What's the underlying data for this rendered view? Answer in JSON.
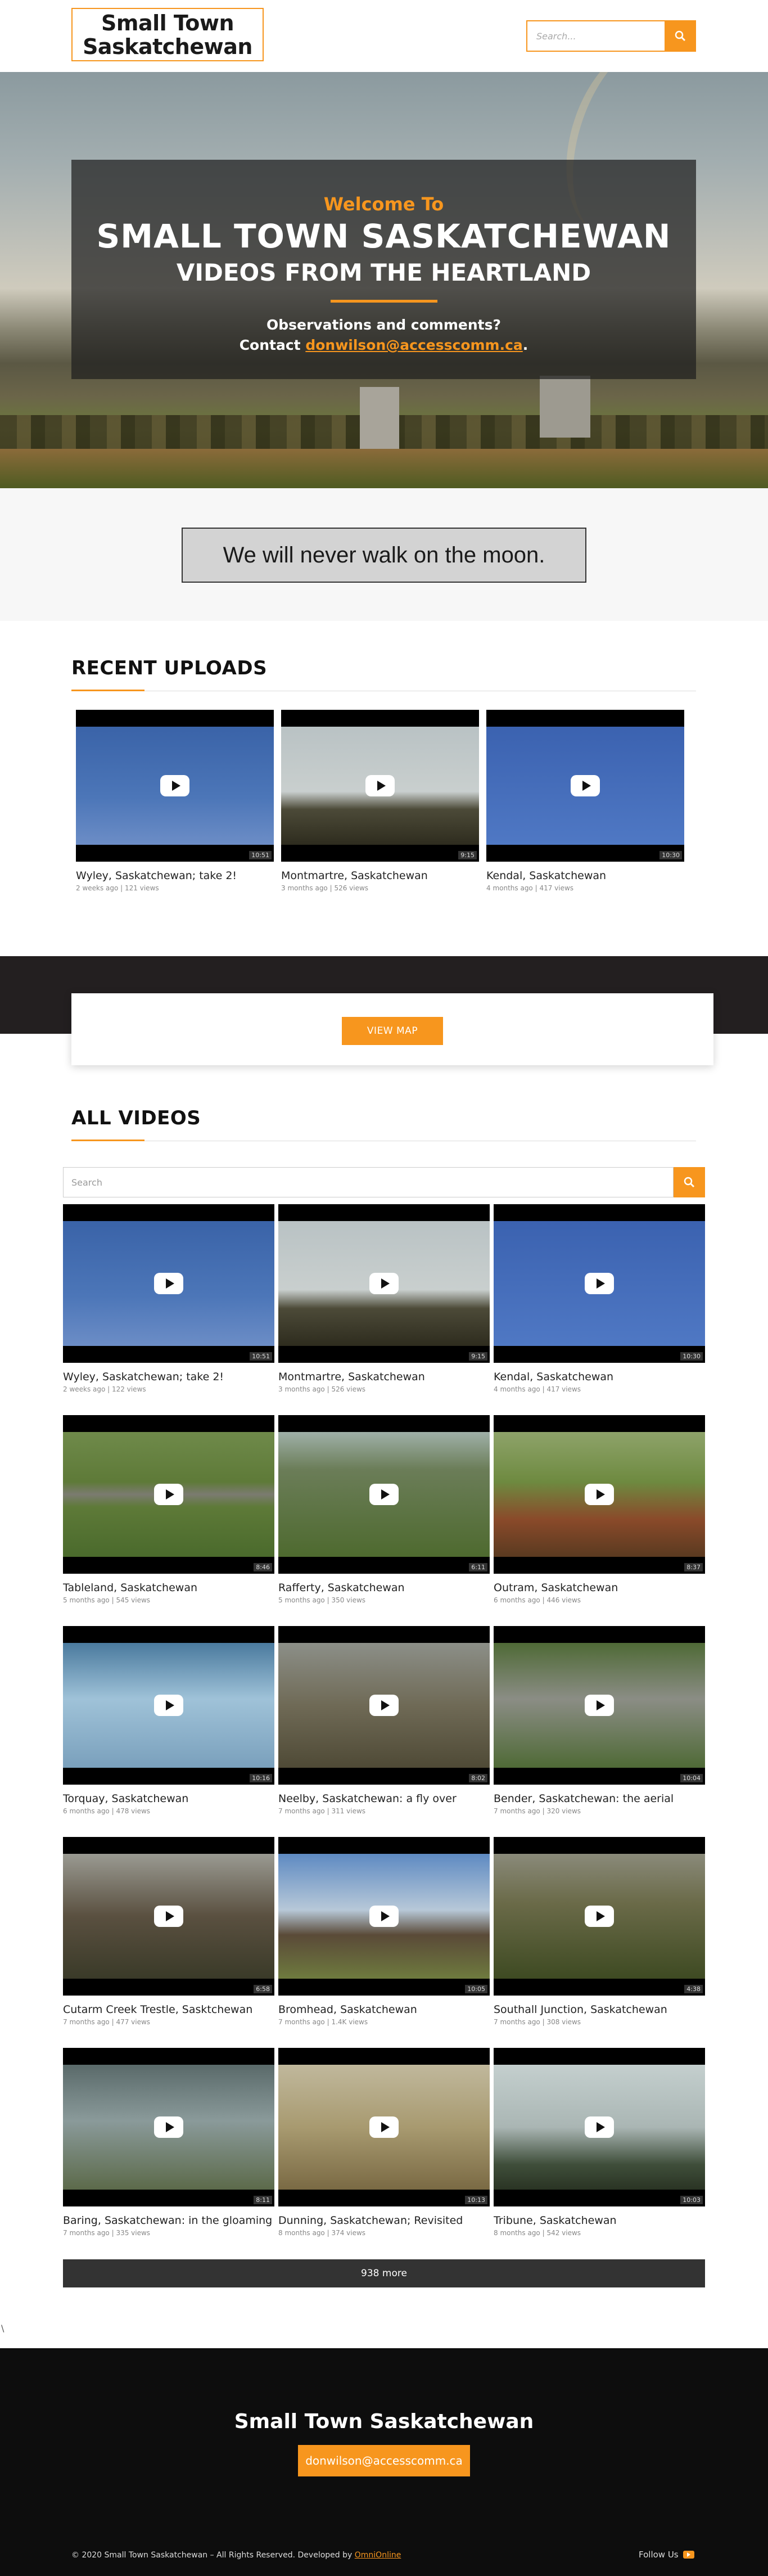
{
  "header": {
    "logo_line1": "Small Town",
    "logo_line2": "Saskatchewan",
    "search_placeholder": "Search..."
  },
  "hero": {
    "welcome": "Welcome To",
    "title": "SMALL TOWN SASKATCHEWAN",
    "subtitle": "VIDEOS FROM THE HEARTLAND",
    "observations": "Observations and comments?",
    "contact_label": "Contact",
    "contact_email": "donwilson@accesscomm.ca",
    "contact_suffix": "."
  },
  "quote": "We will never walk on the moon.",
  "recent": {
    "title": "RECENT UPLOADS",
    "videos": [
      {
        "title": "Wyley, Saskatchewan; take 2!",
        "meta": "2 weeks ago | 121 views",
        "duration": "10:51"
      },
      {
        "title": "Montmartre, Saskatchewan",
        "meta": "3 months ago | 526 views",
        "duration": "9:15"
      },
      {
        "title": "Kendal, Saskatchewan",
        "meta": "4 months ago | 417 views",
        "duration": "10:30"
      }
    ]
  },
  "map": {
    "button": "VIEW MAP"
  },
  "all": {
    "title": "ALL VIDEOS",
    "search_placeholder": "Search",
    "videos": [
      {
        "title": "Wyley, Saskatchewan; take 2!",
        "meta": "2 weeks ago | 122 views",
        "duration": "10:51"
      },
      {
        "title": "Montmartre, Saskatchewan",
        "meta": "3 months ago | 526 views",
        "duration": "9:15"
      },
      {
        "title": "Kendal, Saskatchewan",
        "meta": "4 months ago | 417 views",
        "duration": "10:30"
      },
      {
        "title": "Tableland, Saskatchewan",
        "meta": "5 months ago | 545 views",
        "duration": "8:46"
      },
      {
        "title": "Rafferty, Saskatchewan",
        "meta": "5 months ago | 350 views",
        "duration": "6:11"
      },
      {
        "title": "Outram, Saskatchewan",
        "meta": "6 months ago | 446 views",
        "duration": "8:37"
      },
      {
        "title": "Torquay, Saskatchewan",
        "meta": "6 months ago | 478 views",
        "duration": "10:16"
      },
      {
        "title": "Neelby, Saskatchewan: a fly over",
        "meta": "7 months ago | 311 views",
        "duration": "8:02"
      },
      {
        "title": "Bender, Saskatchewan: the aerial",
        "meta": "7 months ago | 320 views",
        "duration": "10:04"
      },
      {
        "title": "Cutarm Creek Trestle, Sasktchewan",
        "meta": "7 months ago | 477 views",
        "duration": "6:58"
      },
      {
        "title": "Bromhead, Saskatchewan",
        "meta": "7 months ago | 1.4K views",
        "duration": "10:05"
      },
      {
        "title": "Southall Junction, Saskatchewan",
        "meta": "7 months ago | 308 views",
        "duration": "4:38"
      },
      {
        "title": "Baring, Saskatchewan: in the gloaming",
        "meta": "7 months ago | 335 views",
        "duration": "8:11"
      },
      {
        "title": "Dunning, Saskatchewan; Revisited",
        "meta": "8 months ago | 374 views",
        "duration": "10:13"
      },
      {
        "title": "Tribune, Saskatchewan",
        "meta": "8 months ago | 542 views",
        "duration": "10:03"
      }
    ],
    "more_button": "938 more"
  },
  "stray_char": "\\",
  "footer": {
    "title": "Small Town Saskatchewan",
    "email": "donwilson@accesscomm.ca",
    "copyright": "© 2020 Small Town Saskatchewan – All Rights Reserved. Developed by",
    "developer": "OmniOnline",
    "follow": "Follow Us"
  },
  "colors": {
    "accent": "#f7961e",
    "dark": "#231f20",
    "footer": "#0d0d0d"
  }
}
